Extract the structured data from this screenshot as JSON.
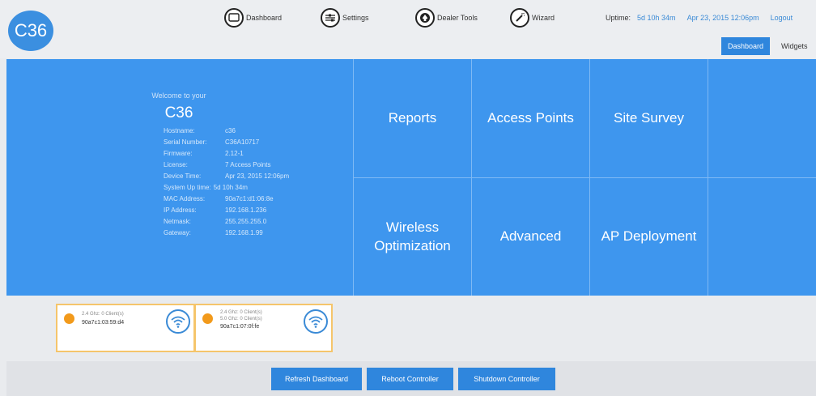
{
  "header": {
    "logo_text": "C36",
    "nav": [
      {
        "label": "Dashboard",
        "icon": "monitor-icon"
      },
      {
        "label": "Settings",
        "icon": "sliders-icon"
      },
      {
        "label": "Dealer Tools",
        "icon": "spade-icon"
      },
      {
        "label": "Wizard",
        "icon": "wand-icon"
      }
    ],
    "uptime_label": "Uptime:",
    "uptime_value": "5d 10h 34m",
    "datetime": "Apr 23, 2015 12:06pm",
    "logout": "Logout",
    "tabs": [
      {
        "label": "Dashboard",
        "active": true
      },
      {
        "label": "Widgets",
        "active": false
      }
    ]
  },
  "info": {
    "welcome": "Welcome to your",
    "model": "C36",
    "rows": [
      {
        "k": "Hostname:",
        "v": "c36"
      },
      {
        "k": "Serial Number:",
        "v": "C36A10717"
      },
      {
        "k": "Firmware:",
        "v": "2.12-1"
      },
      {
        "k": "License:",
        "v": "7 Access Points"
      },
      {
        "k": "Device Time:",
        "v": "Apr 23, 2015 12:06pm"
      },
      {
        "k": "System Up time:",
        "v": "5d 10h 34m"
      },
      {
        "k": "MAC Address:",
        "v": "90a7c1:d1:06:8e"
      },
      {
        "k": "IP Address:",
        "v": "192.168.1.236"
      },
      {
        "k": "Netmask:",
        "v": "255.255.255.0"
      },
      {
        "k": "Gateway:",
        "v": "192.168.1.99"
      }
    ]
  },
  "tiles": {
    "reports": "Reports",
    "access_points": "Access Points",
    "site_survey": "Site Survey",
    "wireless_line1": "Wireless",
    "wireless_line2": "Optimization",
    "advanced": "Advanced",
    "ap_deployment": "AP Deployment"
  },
  "cards": [
    {
      "lines": [
        "2.4 Ghz: 0 Client(s)"
      ],
      "mac": "90a7c1:03:59:d4"
    },
    {
      "lines": [
        "2.4 Ghz: 0 Client(s)",
        "5.0 Ghz: 0 Client(s)"
      ],
      "mac": "90a7c1:07:0f:fe"
    }
  ],
  "buttons": {
    "refresh": "Refresh Dashboard",
    "reboot": "Reboot Controller",
    "shutdown": "Shutdown Controller"
  },
  "colors": {
    "accent": "#3e96ee",
    "button": "#2f86dd",
    "warning": "#f29a1b"
  }
}
